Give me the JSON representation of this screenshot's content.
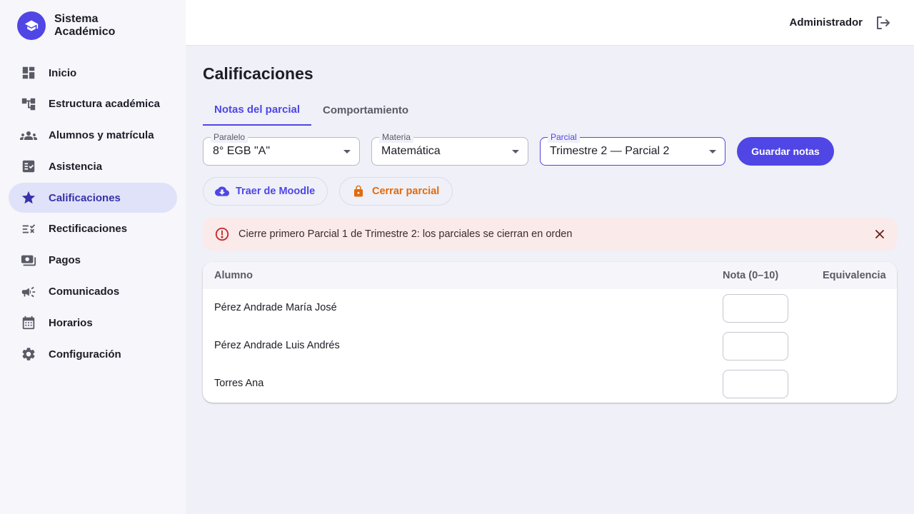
{
  "app": {
    "name": "Sistema Académico"
  },
  "sidebar": {
    "items": [
      {
        "label": "Inicio",
        "icon": "dashboard-icon"
      },
      {
        "label": "Estructura académica",
        "icon": "hierarchy-icon"
      },
      {
        "label": "Alumnos y matrícula",
        "icon": "group-icon"
      },
      {
        "label": "Asistencia",
        "icon": "checklist-icon"
      },
      {
        "label": "Calificaciones",
        "icon": "star-icon",
        "active": true
      },
      {
        "label": "Rectificaciones",
        "icon": "rule-edit-icon"
      },
      {
        "label": "Pagos",
        "icon": "payments-icon"
      },
      {
        "label": "Comunicados",
        "icon": "megaphone-icon"
      },
      {
        "label": "Horarios",
        "icon": "calendar-icon"
      },
      {
        "label": "Configuración",
        "icon": "gear-icon"
      }
    ]
  },
  "header": {
    "user": "Administrador",
    "logout_icon": "logout-icon"
  },
  "page": {
    "title": "Calificaciones"
  },
  "tabs": [
    {
      "label": "Notas del parcial",
      "active": true
    },
    {
      "label": "Comportamiento",
      "active": false
    }
  ],
  "filters": {
    "paralelo": {
      "label": "Paralelo",
      "value": "8° EGB \"A\""
    },
    "materia": {
      "label": "Materia",
      "value": "Matemática"
    },
    "parcial": {
      "label": "Parcial",
      "value": "Trimestre 2 — Parcial 2"
    }
  },
  "actions": {
    "save": "Guardar notas",
    "moodle": "Traer de Moodle",
    "close_partial": "Cerrar parcial"
  },
  "alert": {
    "message": "Cierre primero Parcial 1 de Trimestre 2: los parciales se cierran en orden"
  },
  "table": {
    "headers": {
      "student": "Alumno",
      "grade": "Nota (0–10)",
      "equivalence": "Equivalencia"
    },
    "rows": [
      {
        "student": "Pérez Andrade María José",
        "grade": "",
        "equivalence": ""
      },
      {
        "student": "Pérez Andrade Luis Andrés",
        "grade": "",
        "equivalence": ""
      },
      {
        "student": "Torres Ana",
        "grade": "",
        "equivalence": ""
      }
    ]
  },
  "colors": {
    "primary": "#4f46e5",
    "warning": "#e46a0c",
    "danger": "#c62828",
    "sidebar_active_bg": "#e0e2f9"
  }
}
